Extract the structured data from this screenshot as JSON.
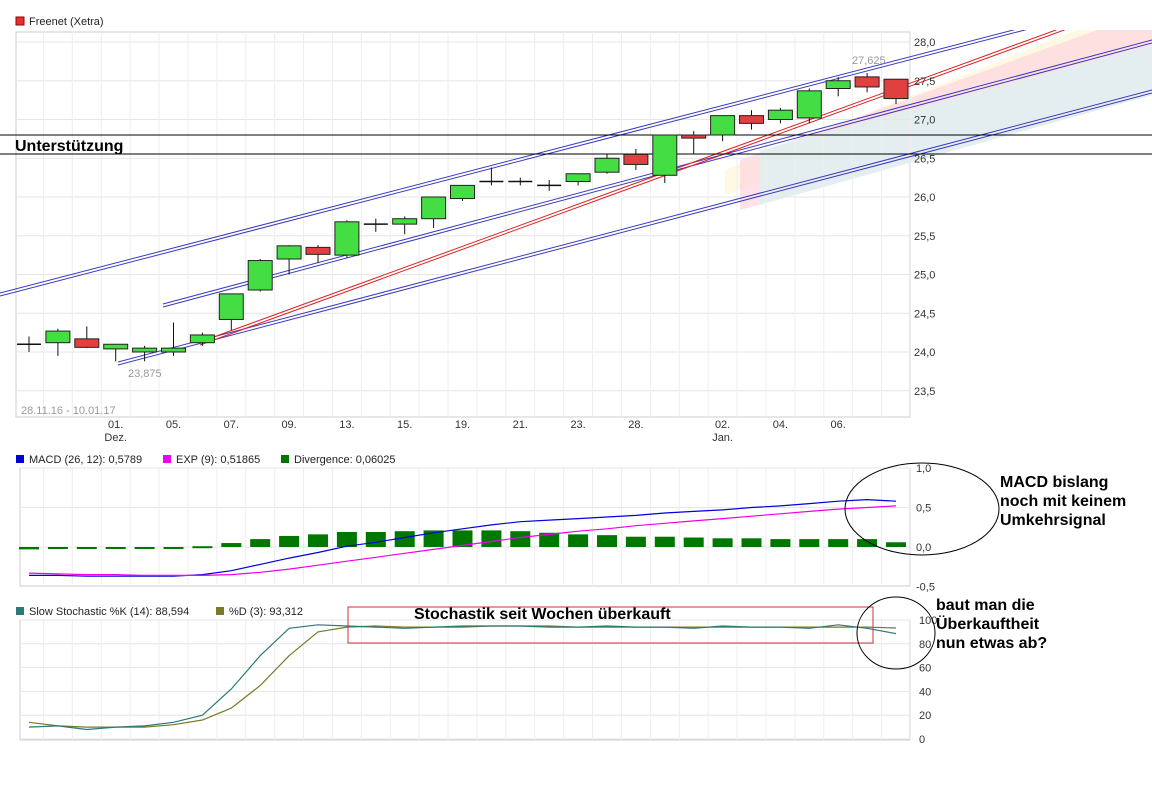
{
  "chart_data": [
    {
      "type": "candlestick",
      "legend": "Freenet (Xetra)",
      "date_range": "28.11.16 - 10.01.17",
      "price_labels": {
        "high": "27,625",
        "low": "23,875"
      },
      "annotation": "Unterstützung",
      "ylim": [
        23.2,
        28.1
      ],
      "y_ticks": [
        "28,0",
        "27,5",
        "27,0",
        "26,5",
        "26,0",
        "25,5",
        "25,0",
        "24,5",
        "24,0",
        "23,5"
      ],
      "y_tick_values": [
        28.0,
        27.5,
        27.0,
        26.5,
        26.0,
        25.5,
        25.0,
        24.5,
        24.0,
        23.5
      ],
      "x_ticks": [
        "01.",
        "05.",
        "07.",
        "09.",
        "13.",
        "15.",
        "19.",
        "21.",
        "23.",
        "28.",
        "02.",
        "04.",
        "06."
      ],
      "x_tick_index": [
        3,
        5,
        7,
        9,
        11,
        13,
        15,
        17,
        19,
        21,
        24,
        26,
        28
      ],
      "month_labels": [
        {
          "text": "Dez.",
          "index": 3
        },
        {
          "text": "Jan.",
          "index": 24
        }
      ],
      "candles": [
        {
          "o": 24.1,
          "h": 24.2,
          "l": 24.0,
          "c": 24.1
        },
        {
          "o": 24.12,
          "h": 24.3,
          "l": 23.95,
          "c": 24.27
        },
        {
          "o": 24.17,
          "h": 24.33,
          "l": 24.05,
          "c": 24.06
        },
        {
          "o": 24.04,
          "h": 24.1,
          "l": 23.88,
          "c": 24.1
        },
        {
          "o": 24.0,
          "h": 24.08,
          "l": 23.88,
          "c": 24.05
        },
        {
          "o": 24.0,
          "h": 24.38,
          "l": 23.95,
          "c": 24.05
        },
        {
          "o": 24.12,
          "h": 24.25,
          "l": 24.08,
          "c": 24.22
        },
        {
          "o": 24.42,
          "h": 24.75,
          "l": 24.28,
          "c": 24.75
        },
        {
          "o": 24.8,
          "h": 25.2,
          "l": 24.78,
          "c": 25.18
        },
        {
          "o": 25.2,
          "h": 25.38,
          "l": 25.0,
          "c": 25.37
        },
        {
          "o": 25.35,
          "h": 25.38,
          "l": 25.15,
          "c": 25.26
        },
        {
          "o": 25.25,
          "h": 25.7,
          "l": 25.22,
          "c": 25.68
        },
        {
          "o": 25.65,
          "h": 25.72,
          "l": 25.55,
          "c": 25.65
        },
        {
          "o": 25.65,
          "h": 25.75,
          "l": 25.52,
          "c": 25.72
        },
        {
          "o": 25.72,
          "h": 26.0,
          "l": 25.6,
          "c": 26.0
        },
        {
          "o": 25.98,
          "h": 26.15,
          "l": 25.95,
          "c": 26.15
        },
        {
          "o": 26.2,
          "h": 26.38,
          "l": 26.15,
          "c": 26.2
        },
        {
          "o": 26.2,
          "h": 26.25,
          "l": 26.15,
          "c": 26.2
        },
        {
          "o": 26.15,
          "h": 26.22,
          "l": 26.08,
          "c": 26.15
        },
        {
          "o": 26.2,
          "h": 26.3,
          "l": 26.15,
          "c": 26.3
        },
        {
          "o": 26.32,
          "h": 26.55,
          "l": 26.3,
          "c": 26.5
        },
        {
          "o": 26.55,
          "h": 26.62,
          "l": 26.35,
          "c": 26.42
        },
        {
          "o": 26.28,
          "h": 26.8,
          "l": 26.18,
          "c": 26.8
        },
        {
          "o": 26.8,
          "h": 26.85,
          "l": 26.55,
          "c": 26.76
        },
        {
          "o": 26.8,
          "h": 27.05,
          "l": 26.72,
          "c": 27.05
        },
        {
          "o": 27.05,
          "h": 27.12,
          "l": 26.87,
          "c": 26.95
        },
        {
          "o": 27.0,
          "h": 27.15,
          "l": 26.95,
          "c": 27.12
        },
        {
          "o": 27.02,
          "h": 27.4,
          "l": 26.95,
          "c": 27.37
        },
        {
          "o": 27.4,
          "h": 27.55,
          "l": 27.3,
          "c": 27.5
        },
        {
          "o": 27.55,
          "h": 27.6,
          "l": 27.35,
          "c": 27.42
        },
        {
          "o": 27.52,
          "h": 27.52,
          "l": 27.2,
          "c": 27.27
        }
      ]
    },
    {
      "type": "bar+line",
      "series": [
        {
          "name": "MACD (26, 12): 0,5789",
          "color": "#0000dd"
        },
        {
          "name": "EXP (9): 0,51865",
          "color": "#ee00ee"
        },
        {
          "name": "Divergence: 0,06025",
          "color": "#007700"
        }
      ],
      "ylim": [
        -0.5,
        1.0
      ],
      "y_ticks": [
        "1,0",
        "0,5",
        "0,0",
        "-0,5"
      ],
      "y_tick_values": [
        1.0,
        0.5,
        0.0,
        -0.5
      ],
      "macd": [
        -0.36,
        -0.36,
        -0.37,
        -0.37,
        -0.37,
        -0.37,
        -0.35,
        -0.3,
        -0.22,
        -0.14,
        -0.07,
        0.01,
        0.06,
        0.12,
        0.18,
        0.23,
        0.28,
        0.32,
        0.34,
        0.36,
        0.38,
        0.4,
        0.43,
        0.45,
        0.47,
        0.5,
        0.52,
        0.55,
        0.58,
        0.6,
        0.58
      ],
      "signal": [
        -0.33,
        -0.34,
        -0.35,
        -0.35,
        -0.36,
        -0.36,
        -0.36,
        -0.35,
        -0.32,
        -0.28,
        -0.23,
        -0.18,
        -0.13,
        -0.08,
        -0.03,
        0.02,
        0.07,
        0.12,
        0.16,
        0.2,
        0.23,
        0.27,
        0.3,
        0.33,
        0.36,
        0.39,
        0.42,
        0.45,
        0.48,
        0.5,
        0.52
      ],
      "divergence": [
        -0.03,
        -0.02,
        -0.02,
        -0.02,
        -0.01,
        -0.01,
        0.01,
        0.05,
        0.1,
        0.14,
        0.16,
        0.19,
        0.19,
        0.2,
        0.21,
        0.21,
        0.21,
        0.2,
        0.18,
        0.16,
        0.15,
        0.13,
        0.13,
        0.12,
        0.11,
        0.11,
        0.1,
        0.1,
        0.1,
        0.1,
        0.06
      ],
      "annotation": [
        "MACD bislang",
        "noch mit keinem",
        "Umkehrsignal"
      ]
    },
    {
      "type": "line",
      "series": [
        {
          "name": "Slow Stochastic %K (14): 88,594",
          "color": "#2b7a78"
        },
        {
          "name": "%D (3): 93,312",
          "color": "#7a7a2a"
        }
      ],
      "ylim": [
        0,
        100
      ],
      "y_ticks": [
        "100",
        "80",
        "60",
        "40",
        "20",
        "0"
      ],
      "y_tick_values": [
        100,
        80,
        60,
        40,
        20,
        0
      ],
      "k": [
        10,
        11,
        8,
        10,
        11,
        14,
        20,
        42,
        70,
        93,
        96,
        95,
        94,
        93,
        94,
        95,
        95,
        95,
        94,
        94,
        95,
        94,
        94,
        93,
        95,
        94,
        94,
        93,
        96,
        93,
        88.6
      ],
      "d": [
        14,
        11,
        10,
        10,
        10,
        12,
        16,
        26,
        45,
        70,
        90,
        94,
        95,
        94,
        94,
        94,
        95,
        95,
        95,
        94,
        94,
        94,
        94,
        94,
        94,
        94,
        94,
        94,
        94,
        94,
        93.3
      ],
      "annotation_box": "Stochastik seit Wochen überkauft",
      "annotation_side": [
        "baut man die",
        "Überkauftheit",
        "nun etwas ab?"
      ]
    }
  ]
}
